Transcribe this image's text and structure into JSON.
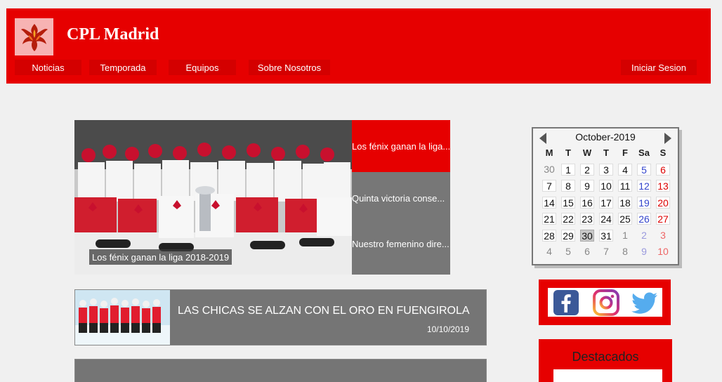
{
  "header": {
    "title": "CPL Madrid",
    "logo_icon": "phoenix-icon",
    "nav": {
      "noticias": "Noticias",
      "temporada": "Temporada",
      "equipos": "Equipos",
      "sobre": "Sobre Nosotros",
      "login": "Iniciar Sesion"
    }
  },
  "carousel": {
    "caption": "Los fénix ganan la liga 2018-2019",
    "tabs": [
      "Los fénix ganan la liga...",
      "Quinta victoria conse...",
      "Nuestro femenino dire..."
    ]
  },
  "news": [
    {
      "title": "LAS CHICAS SE ALZAN CON EL ORO EN FUENGIROLA",
      "date": "10/10/2019"
    }
  ],
  "calendar": {
    "title": "October-2019",
    "headers": [
      "M",
      "T",
      "W",
      "T",
      "F",
      "Sa",
      "S"
    ],
    "weeks": [
      [
        "30",
        "1",
        "2",
        "3",
        "4",
        "5",
        "6"
      ],
      [
        "7",
        "8",
        "9",
        "10",
        "11",
        "12",
        "13"
      ],
      [
        "14",
        "15",
        "16",
        "17",
        "18",
        "19",
        "20"
      ],
      [
        "21",
        "22",
        "23",
        "24",
        "25",
        "26",
        "27"
      ],
      [
        "28",
        "29",
        "30",
        "31",
        "1",
        "2",
        "3"
      ],
      [
        "4",
        "5",
        "6",
        "7",
        "8",
        "9",
        "10"
      ]
    ],
    "today": "30"
  },
  "social": {
    "icons": [
      "facebook-icon",
      "instagram-icon",
      "twitter-icon"
    ]
  },
  "featured": {
    "title": "Destacados"
  },
  "colors": {
    "brand_red": "#e60000",
    "card_gray": "#757575",
    "background": "#f0f0f0"
  }
}
